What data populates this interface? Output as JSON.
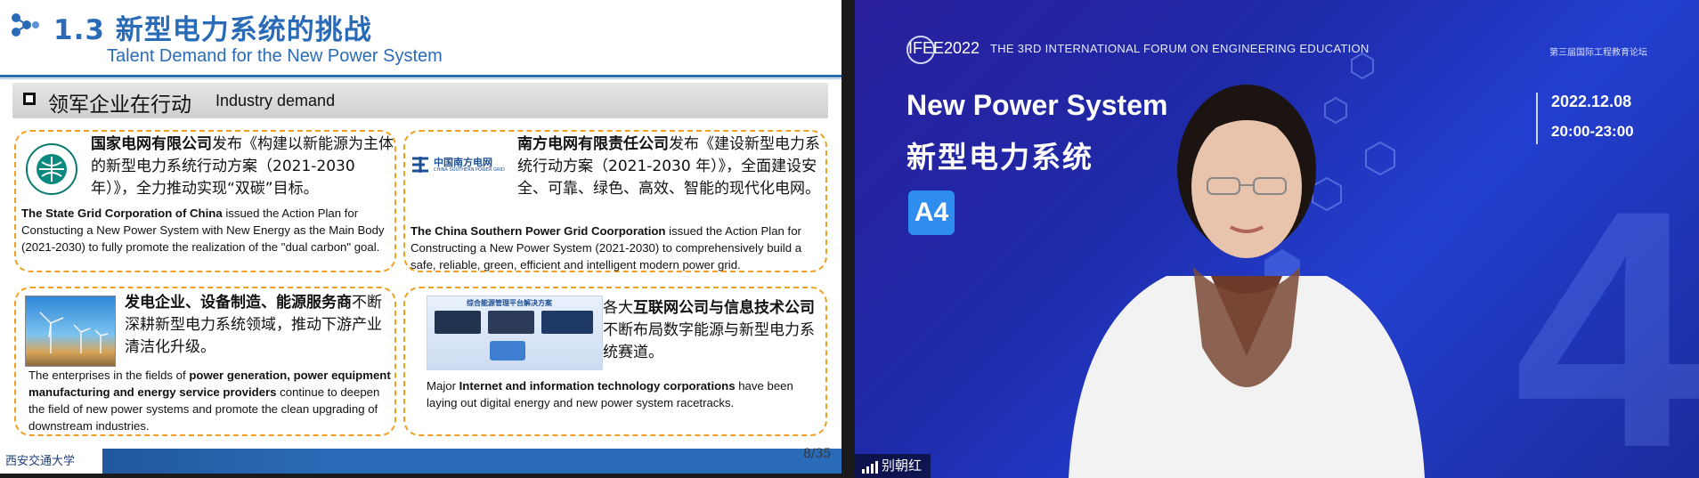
{
  "slide": {
    "title": "1.3 新型电力系统的挑战",
    "subtitle": "Talent Demand for the New Power System",
    "section_zh": "领军企业在行动",
    "section_en": "Industry demand",
    "cards": [
      {
        "zh_company": "国家电网有限公司",
        "zh_rest": "发布《构建以新能源为主体的新型电力系统行动方案（2021-2030年）》，全力推动实现“双碳”目标。",
        "en_company": "The State Grid Corporation of China",
        "en_rest": " issued the Action Plan for Constucting a New Power System with New Energy as the Main Body (2021-2030) to fully promote the realization of the \"dual carbon\" goal."
      },
      {
        "zh_company": "南方电网有限责任公司",
        "zh_rest": "发布《建设新型电力系统行动方案（2021-2030 年）》，全面建设安全、可靠、绿色、高效、智能的现代化电网。",
        "en_company": "The China Southern Power Grid Coorporation",
        "en_rest": " issued the Action Plan for Constructing a New Power System (2021-2030) to comprehensively build a safe, reliable, green, efficient and intelligent modern power grid.",
        "logo_zh": "中国南方电网",
        "logo_en": "CHINA SOUTHERN POWER GRID"
      },
      {
        "zh_company": "发电企业、设备制造、能源服务商",
        "zh_rest": "不断深耕新型电力系统领域，推动下游产业清洁化升级。",
        "en_prefix": "The enterprises in the fields of ",
        "en_company": "power generation, power equipment manufacturing and energy service providers",
        "en_rest": " continue to deepen the field of new power systems and promote the clean upgrading of downstream industries."
      },
      {
        "zh_prefix": "各大",
        "zh_company": "互联网公司与信息技术公司",
        "zh_rest": "不断布局数字能源与新型电力系统赛道。",
        "en_prefix": "Major ",
        "en_company": "Internet and information technology corporations",
        "en_rest": " have been laying out digital energy and new power system racetracks.",
        "image_caption": "综合能源管理平台解决方案"
      }
    ],
    "university": "西安交通大学",
    "page": "8/35"
  },
  "video": {
    "forum_logo": "IFEE2022",
    "forum_name": "THE 3RD INTERNATIONAL FORUM ON ENGINEERING EDUCATION",
    "forum_cn": "第三届国际工程教育论坛",
    "title_en": "New Power System",
    "title_zh": "新型电力系统",
    "date": "2022.12.08",
    "time": "20:00-23:00",
    "session": "A4",
    "speaker_name": "别朝红"
  },
  "colors": {
    "brand_blue": "#2a6bb7",
    "card_border": "#f0a020",
    "video_bg": "#1e2aa8",
    "badge": "#2f8df0"
  },
  "icons": [
    "molecule-icon",
    "sgcc-logo-icon",
    "csg-logo-icon",
    "signal-bars-icon"
  ]
}
